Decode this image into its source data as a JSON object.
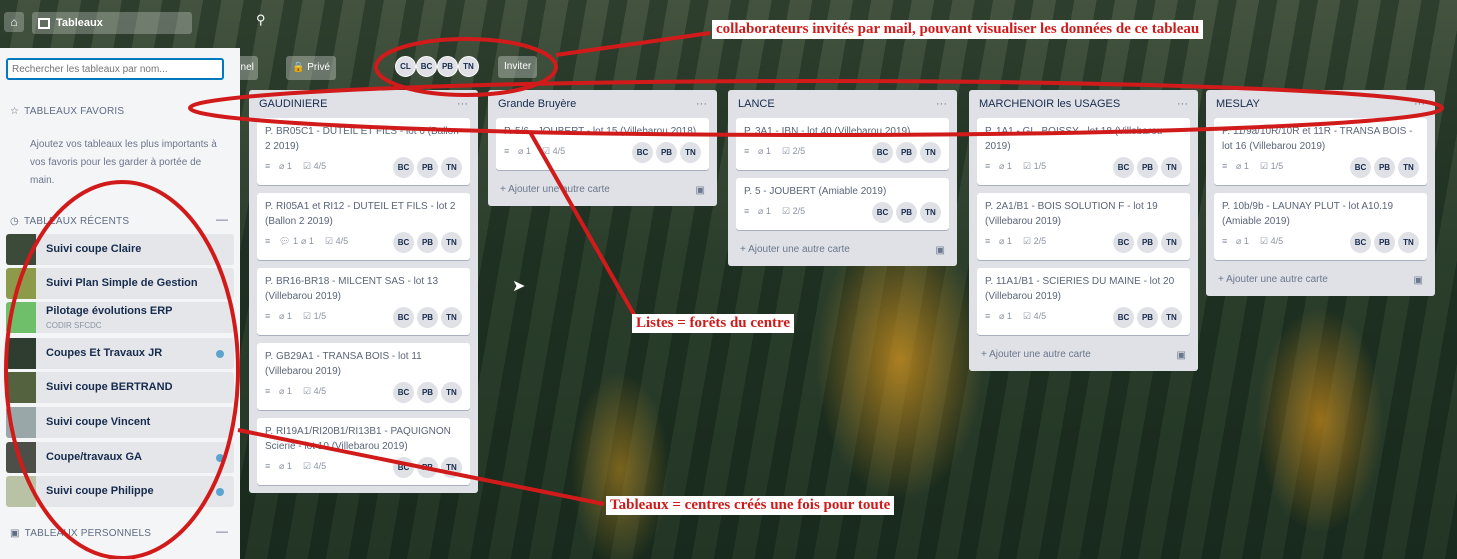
{
  "header": {
    "boards_label": "Tableaux",
    "home_icon": "home-icon",
    "search_icon": "search-icon"
  },
  "board_header": {
    "partial_label": "nnel",
    "privacy_label": "Privé",
    "members": [
      "CL",
      "BC",
      "PB",
      "TN"
    ],
    "invite_label": "Inviter"
  },
  "drawer": {
    "search_placeholder": "Rechercher les tableaux par nom...",
    "favorites_title": "TABLEAUX FAVORIS",
    "favorites_help": "Ajoutez vos tableaux les plus importants à vos favoris pour les garder à portée de main.",
    "recent_title": "TABLEAUX RÉCENTS",
    "personal_title": "TABLEAUX PERSONNELS",
    "collapse_symbol": "—",
    "recent_boards": [
      {
        "name": "Suivi coupe Claire",
        "sub": "",
        "dot": false,
        "thumb": "#3c4a3a"
      },
      {
        "name": "Suivi Plan Simple de Gestion",
        "sub": "",
        "dot": false,
        "thumb": "#8c9a4a"
      },
      {
        "name": "Pilotage évolutions ERP",
        "sub": "CODIR SFCDC",
        "dot": false,
        "thumb": "#6fbf6a"
      },
      {
        "name": "Coupes Et Travaux JR",
        "sub": "",
        "dot": true,
        "thumb": "#2f3d30"
      },
      {
        "name": "Suivi coupe BERTRAND",
        "sub": "",
        "dot": false,
        "thumb": "#55623f"
      },
      {
        "name": "Suivi coupe Vincent",
        "sub": "",
        "dot": false,
        "thumb": "#9aa7a8"
      },
      {
        "name": "Coupe/travaux GA",
        "sub": "",
        "dot": true,
        "thumb": "#4b4f47"
      },
      {
        "name": "Suivi coupe Philippe",
        "sub": "",
        "dot": true,
        "thumb": "#b9c2a5"
      }
    ]
  },
  "lists": [
    {
      "title": "GAUDINIERE",
      "more": "···",
      "cards": [
        {
          "title": "P. BR05C1 - DUTEIL ET FILS - lot 6 (Ballon 2 2019)",
          "comments": "",
          "attachments": "1",
          "checklist": "4/5"
        },
        {
          "title": "P. RI05A1 et RI12 - DUTEIL ET FILS - lot 2 (Ballon 2 2019)",
          "comments": "1",
          "attachments": "1",
          "checklist": "4/5"
        },
        {
          "title": "P. BR16-BR18 - MILCENT SAS - lot 13 (Villebarou 2019)",
          "comments": "",
          "attachments": "1",
          "checklist": "1/5"
        },
        {
          "title": "P. GB29A1 - TRANSA BOIS - lot 11 (Villebarou 2019)",
          "comments": "",
          "attachments": "1",
          "checklist": "4/5"
        },
        {
          "title": "P. RI19A1/RI20B1/RI13B1 - PAQUIGNON Scierie - lot 10 (Villebarou 2019)",
          "comments": "",
          "attachments": "1",
          "checklist": "4/5"
        }
      ],
      "add_label": ""
    },
    {
      "title": "Grande Bruyère",
      "more": "···",
      "cards": [
        {
          "title": "P. 5/6 - JOUBERT - lot 15 (Villebarou 2018)",
          "comments": "",
          "attachments": "1",
          "checklist": "4/5"
        }
      ],
      "add_label": "+ Ajouter une autre carte"
    },
    {
      "title": "LANCE",
      "more": "···",
      "cards": [
        {
          "title": "P. 3A1 - IBN - lot 40 (Villebarou 2019)",
          "comments": "",
          "attachments": "1",
          "checklist": "2/5"
        },
        {
          "title": "P. 5 - JOUBERT (Amiable 2019)",
          "comments": "",
          "attachments": "1",
          "checklist": "2/5"
        }
      ],
      "add_label": "+ Ajouter une autre carte"
    },
    {
      "title": "MARCHENOIR les USAGES",
      "more": "···",
      "cards": [
        {
          "title": "P. 1A1 - GL. BOISSY - lot 18 (Villebarou 2019)",
          "comments": "",
          "attachments": "1",
          "checklist": "1/5"
        },
        {
          "title": "P. 2A1/B1 - BOIS SOLUTION F - lot 19 (Villebarou 2019)",
          "comments": "",
          "attachments": "1",
          "checklist": "2/5"
        },
        {
          "title": "P. 11A1/B1 - SCIERIES DU MAINE - lot 20 (Villebarou 2019)",
          "comments": "",
          "attachments": "1",
          "checklist": "4/5"
        }
      ],
      "add_label": "+ Ajouter une autre carte"
    },
    {
      "title": "MESLAY",
      "more": "···",
      "cards": [
        {
          "title": "P. 11/9a/10R/10R et 11R - TRANSA BOIS - lot 16 (Villebarou 2019)",
          "comments": "",
          "attachments": "1",
          "checklist": "1/5"
        },
        {
          "title": "P. 10b/9b - LAUNAY PLUT - lot A10.19 (Amiable 2019)",
          "comments": "",
          "attachments": "1",
          "checklist": "4/5"
        }
      ],
      "add_label": "+ Ajouter une autre carte"
    }
  ],
  "card_members": [
    "BC",
    "PB",
    "TN"
  ],
  "annotations": {
    "top": "collaborateurs invités par mail, pouvant visualiser les données de ce tableau",
    "middle": "Listes = forêts du centre",
    "bottom": "Tableaux = centres créés une fois pour toute",
    "color": "#d11b1b"
  }
}
